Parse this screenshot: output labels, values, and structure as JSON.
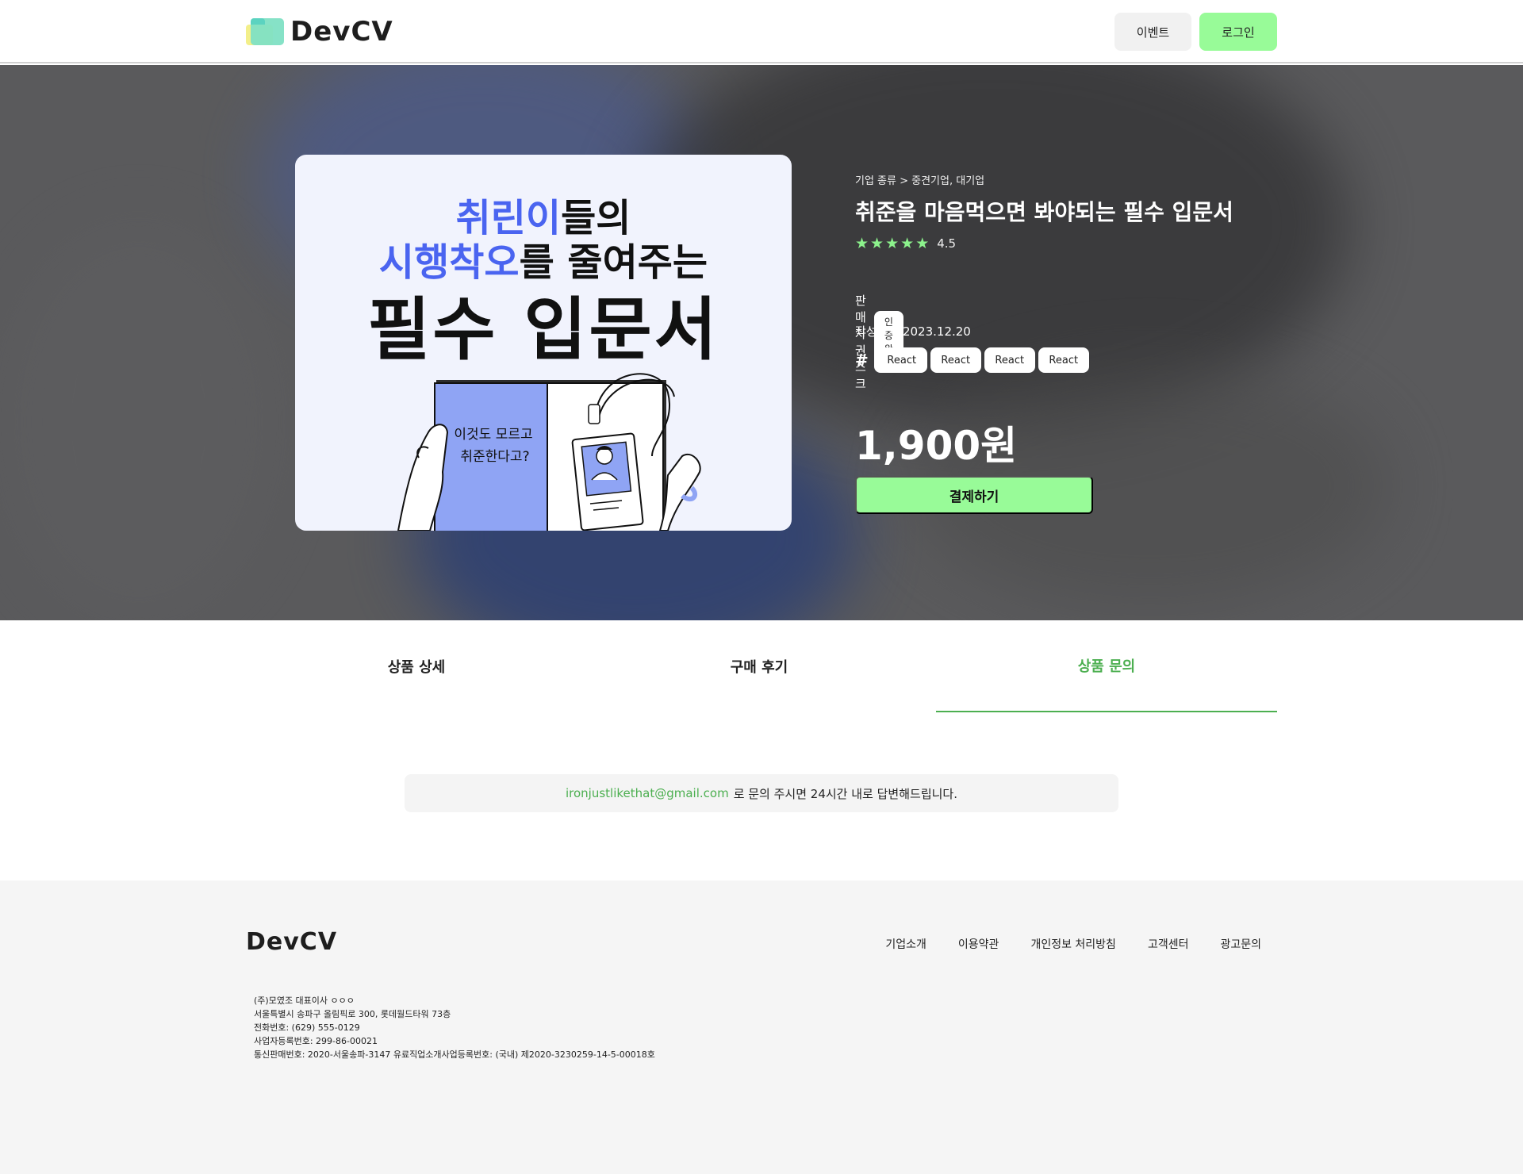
{
  "header": {
    "logo_text": "DevCV",
    "event_label": "이벤트",
    "login_label": "로그인"
  },
  "hero": {
    "thumbnail": {
      "line1_highlight": "취린이",
      "line1_rest": "들의",
      "line2_highlight": "시행착오",
      "line2_rest": "를 줄여주는",
      "line3": "필수 입문서",
      "book_text_1": "이것도 모르고",
      "book_text_2": "취준한다고?"
    },
    "breadcrumb": "기업 종류 > 중견기업, 대기업",
    "title": "취준을 마음먹으면 봐야되는 필수 입문서",
    "rating": {
      "value": "4.5",
      "stars": 5
    },
    "seller_label": "판매자 권스크",
    "verified_badge": "인증 완료",
    "date_label": "작성일자 2023.12.20",
    "hash": "#",
    "tags": [
      "React",
      "React",
      "React",
      "React"
    ],
    "price": "1,900원",
    "pay_label": "결제하기"
  },
  "tabs": {
    "detail": "상품 상세",
    "reviews": "구매 후기",
    "inquiry": "상품 문의",
    "active": "inquiry"
  },
  "notice": {
    "email": "ironjustlikethat@gmail.com",
    "text": "로 문의 주시면 24시간 내로 답변해드립니다."
  },
  "footer": {
    "logo_text": "DevCV",
    "links": [
      "기업소개",
      "이용약관",
      "개인정보 처리방침",
      "고객센터",
      "광고문의"
    ],
    "company_lines": [
      "(주)모였조   대표이사 ㅇㅇㅇ",
      "서울특별시 송파구 올림픽로 300, 롯데월드타워 73층",
      "전화번호: (629) 555-0129",
      "사업자등록번호: 299-86-00021",
      "통신판매번호: 2020-서울송파-3147  유료직업소개사업등록번호: (국내) 제2020-3230259-14-5-00018호"
    ]
  },
  "colors": {
    "accent_green": "#98fb98",
    "active_tab_green": "#4caf50",
    "thumbnail_blue": "#4a64f0",
    "hero_bg": "#5a5a5c"
  }
}
